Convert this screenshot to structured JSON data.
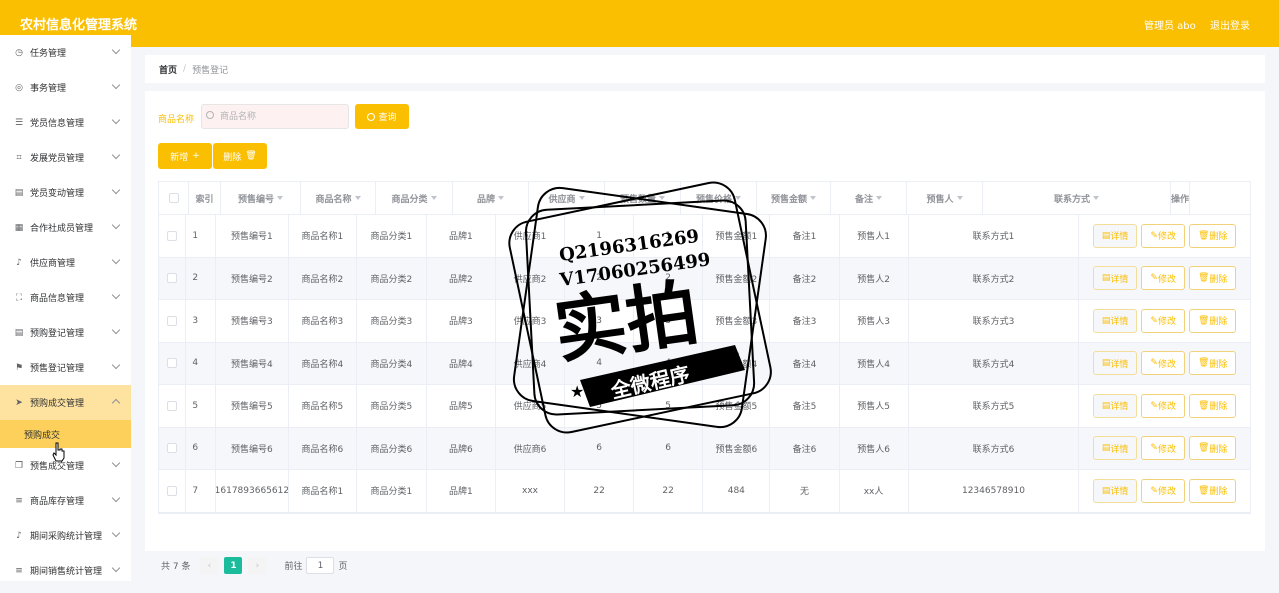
{
  "header": {
    "title": "农村信息化管理系统",
    "user_label": "管理员 abo",
    "logout_label": "退出登录"
  },
  "sidebar": {
    "items": [
      {
        "label": "任务管理",
        "icon": "clock-icon"
      },
      {
        "label": "事务管理",
        "icon": "circle-icon"
      },
      {
        "label": "党员信息管理",
        "icon": "sliders-icon"
      },
      {
        "label": "发展党员管理",
        "icon": "crop-icon"
      },
      {
        "label": "党员变动管理",
        "icon": "clipboard-icon"
      },
      {
        "label": "合作社成员管理",
        "icon": "document-icon"
      },
      {
        "label": "供应商管理",
        "icon": "microphone-icon"
      },
      {
        "label": "商品信息管理",
        "icon": "frame-icon"
      },
      {
        "label": "预购登记管理",
        "icon": "clipboard-icon"
      },
      {
        "label": "预售登记管理",
        "icon": "flag-icon"
      },
      {
        "label": "预购成交管理",
        "icon": "send-icon"
      },
      {
        "label": "预售成交管理",
        "icon": "copy-icon"
      },
      {
        "label": "商品库存管理",
        "icon": "list-icon"
      },
      {
        "label": "期间采购统计管理",
        "icon": "microphone-icon"
      },
      {
        "label": "期间销售统计管理",
        "icon": "list-icon"
      }
    ],
    "active_submenu": "预购成交"
  },
  "breadcrumb": {
    "home": "首页",
    "separator": "/",
    "current": "预售登记"
  },
  "search": {
    "label": "商品名称",
    "placeholder": "商品名称",
    "button_label": "查询"
  },
  "actions": {
    "add_label": "新增",
    "delete_label": "删除"
  },
  "table": {
    "columns": [
      "索引",
      "预售编号",
      "商品名称",
      "商品分类",
      "品牌",
      "供应商",
      "预售数量",
      "预售价格",
      "预售金额",
      "备注",
      "预售人",
      "联系方式",
      "操作"
    ],
    "rows": [
      [
        "1",
        "预售编号1",
        "商品名称1",
        "商品分类1",
        "品牌1",
        "供应商1",
        "1",
        "1",
        "预售金额1",
        "备注1",
        "预售人1",
        "联系方式1"
      ],
      [
        "2",
        "预售编号2",
        "商品名称2",
        "商品分类2",
        "品牌2",
        "供应商2",
        "2",
        "2",
        "预售金额2",
        "备注2",
        "预售人2",
        "联系方式2"
      ],
      [
        "3",
        "预售编号3",
        "商品名称3",
        "商品分类3",
        "品牌3",
        "供应商3",
        "3",
        "3",
        "预售金额3",
        "备注3",
        "预售人3",
        "联系方式3"
      ],
      [
        "4",
        "预售编号4",
        "商品名称4",
        "商品分类4",
        "品牌4",
        "供应商4",
        "4",
        "4",
        "预售金额4",
        "备注4",
        "预售人4",
        "联系方式4"
      ],
      [
        "5",
        "预售编号5",
        "商品名称5",
        "商品分类5",
        "品牌5",
        "供应商5",
        "5",
        "5",
        "预售金额5",
        "备注5",
        "预售人5",
        "联系方式5"
      ],
      [
        "6",
        "预售编号6",
        "商品名称6",
        "商品分类6",
        "品牌6",
        "供应商6",
        "6",
        "6",
        "预售金额6",
        "备注6",
        "预售人6",
        "联系方式6"
      ],
      [
        "7",
        "1617893665612",
        "商品名称1",
        "商品分类1",
        "品牌1",
        "xxx",
        "22",
        "22",
        "484",
        "无",
        "xx人",
        "12346578910"
      ]
    ],
    "op_labels": {
      "detail": "详情",
      "edit": "修改",
      "delete": "删除"
    }
  },
  "pagination": {
    "total_label": "共 7 条",
    "current_page": "1",
    "goto_label": "前往",
    "goto_value": "1",
    "page_suffix": "页"
  },
  "watermark": {
    "line1": "Q2196316269",
    "line2": "V17060256499",
    "big": "实拍",
    "ribbon": "全微程序"
  },
  "colors": {
    "primary": "#fbbf02",
    "pager_active": "#1abc9c"
  }
}
